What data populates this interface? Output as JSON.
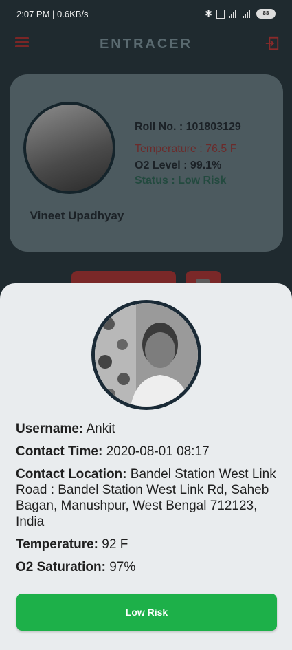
{
  "status_bar": {
    "time_speed": "2:07 PM | 0.6KB/s",
    "battery": "88"
  },
  "app": {
    "title": "ENTRACER"
  },
  "profile": {
    "name": "Vineet Upadhyay",
    "roll": "Roll No. : 101803129",
    "temperature": "Temperature : 76.5 F",
    "o2": "O2 Level : 99.1%",
    "status": "Status : Low Risk"
  },
  "contact": {
    "username_key": "Username:",
    "username": "Ankit",
    "time_key": "Contact Time:",
    "time": "2020-08-01 08:17",
    "location_key": "Contact Location:",
    "location": "Bandel Station West Link Road : Bandel Station West Link Rd, Saheb Bagan, Manushpur, West Bengal 712123, India",
    "temp_key": "Temperature:",
    "temp": "92 F",
    "o2_key": "O2 Saturation:",
    "o2": "97%",
    "risk_label": "Low Risk",
    "risk_color": "#1db049"
  }
}
